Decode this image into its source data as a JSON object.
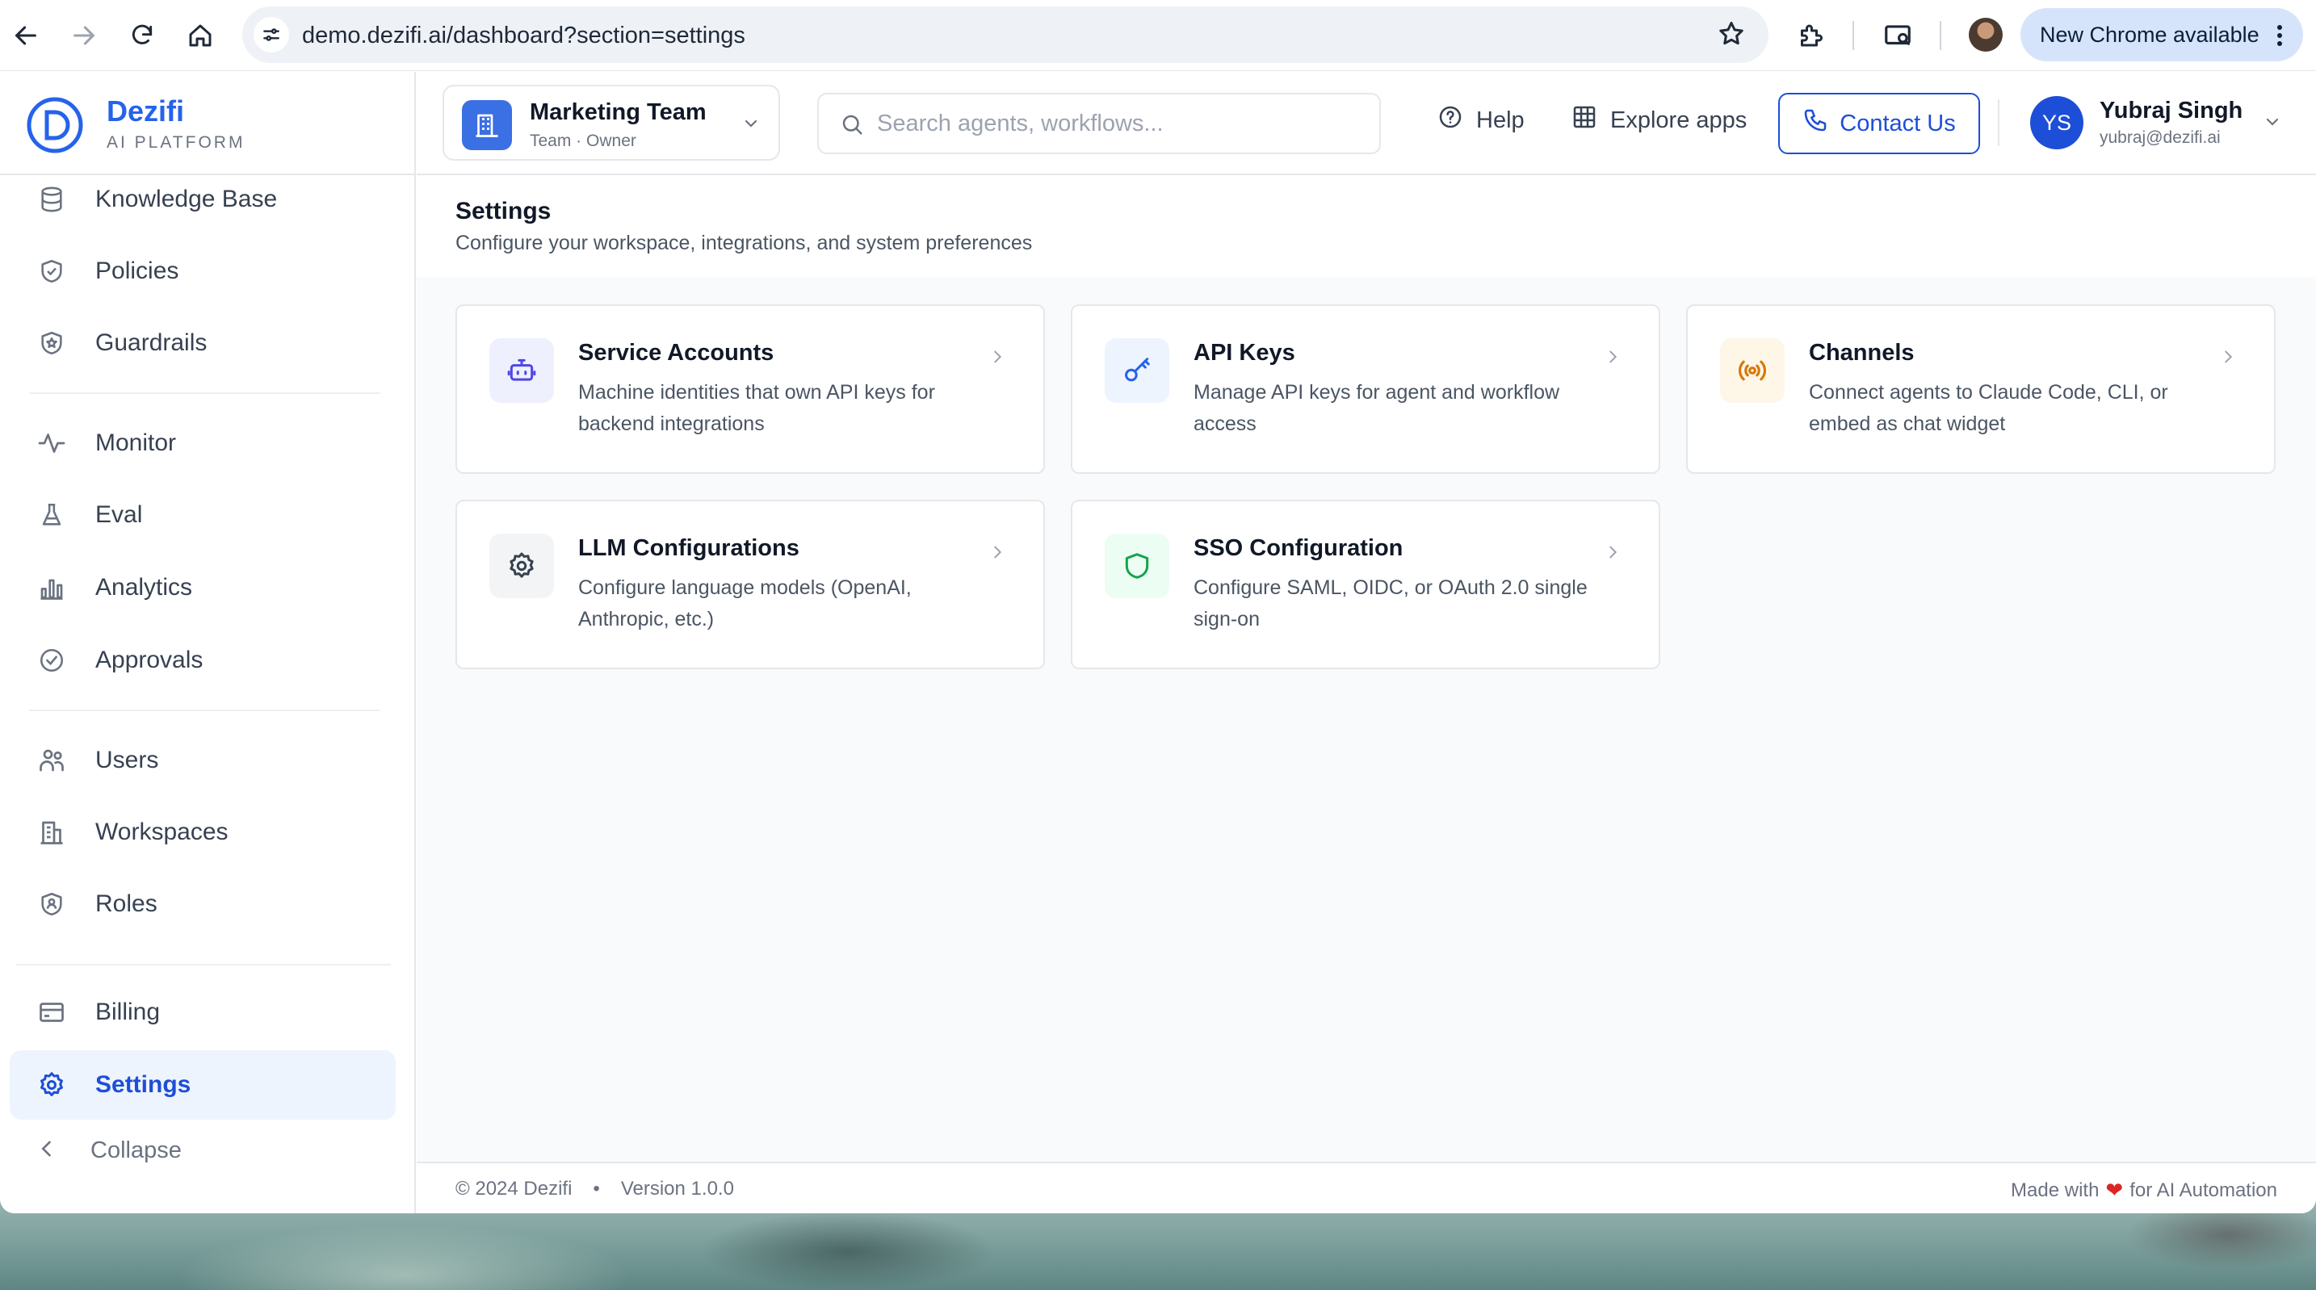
{
  "browser": {
    "url": "demo.dezifi.ai/dashboard?section=settings",
    "update_label": "New Chrome available"
  },
  "brand": {
    "name": "Dezifi",
    "tagline": "AI PLATFORM",
    "accent": "#2563eb"
  },
  "sidebar": {
    "items": [
      {
        "label": "Knowledge Base",
        "icon": "database-icon"
      },
      {
        "label": "Policies",
        "icon": "shield-check-icon"
      },
      {
        "label": "Guardrails",
        "icon": "shield-star-icon"
      },
      {
        "label": "Monitor",
        "icon": "activity-icon"
      },
      {
        "label": "Eval",
        "icon": "flask-icon"
      },
      {
        "label": "Analytics",
        "icon": "bar-chart-icon"
      },
      {
        "label": "Approvals",
        "icon": "check-circle-icon"
      },
      {
        "label": "Users",
        "icon": "users-icon"
      },
      {
        "label": "Workspaces",
        "icon": "building-icon"
      },
      {
        "label": "Roles",
        "icon": "shield-user-icon"
      },
      {
        "label": "Billing",
        "icon": "credit-card-icon"
      },
      {
        "label": "Settings",
        "icon": "gear-icon",
        "active": true
      }
    ],
    "collapse_label": "Collapse"
  },
  "header": {
    "team_name": "Marketing Team",
    "team_role": "Team · Owner",
    "search_placeholder": "Search agents, workflows...",
    "help_label": "Help",
    "explore_label": "Explore apps",
    "contact_label": "Contact Us",
    "user_initials": "YS",
    "user_name": "Yubraj Singh",
    "user_email": "yubraj@dezifi.ai"
  },
  "page": {
    "title": "Settings",
    "subtitle": "Configure your workspace, integrations, and system preferences"
  },
  "cards": [
    {
      "title": "Service Accounts",
      "description": "Machine identities that own API keys for backend integrations",
      "icon": "bot-icon",
      "color": "#4f46e5"
    },
    {
      "title": "API Keys",
      "description": "Manage API keys for agent and workflow access",
      "icon": "key-icon",
      "color": "#2563eb"
    },
    {
      "title": "Channels",
      "description": "Connect agents to Claude Code, CLI, or embed as chat widget",
      "icon": "broadcast-icon",
      "color": "#d97706"
    },
    {
      "title": "LLM Configurations",
      "description": "Configure language models (OpenAI, Anthropic, etc.)",
      "icon": "gear-icon",
      "color": "#374151"
    },
    {
      "title": "SSO Configuration",
      "description": "Configure SAML, OIDC, or OAuth 2.0 single sign-on",
      "icon": "shield-icon",
      "color": "#16a34a"
    }
  ],
  "footer": {
    "copyright": "© 2024 Dezifi",
    "version": "Version 1.0.0",
    "made_with": "Made with",
    "made_for": "for AI Automation"
  }
}
